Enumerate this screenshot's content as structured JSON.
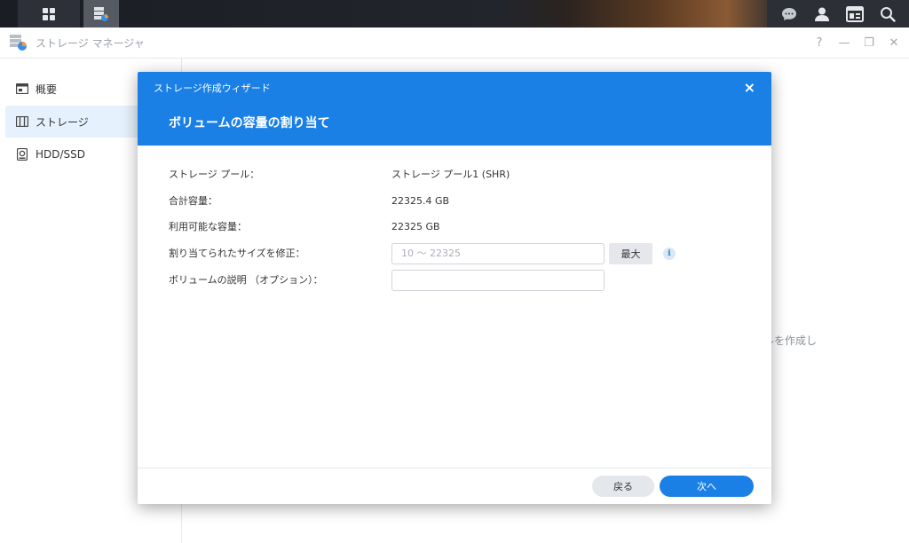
{
  "taskbar": {
    "icons": [
      "main-menu-icon",
      "storage-manager-app-icon",
      "chat-icon",
      "user-icon",
      "widgets-icon",
      "search-icon"
    ]
  },
  "window": {
    "title": "ストレージ マネージャ",
    "controls": {
      "help": "?",
      "minimize": "—",
      "restore": "❐",
      "close": "✕"
    }
  },
  "sidebar": {
    "items": [
      {
        "label": "概要",
        "icon": "overview-icon",
        "active": false
      },
      {
        "label": "ストレージ",
        "icon": "storage-icon",
        "active": true
      },
      {
        "label": "HDD/SSD",
        "icon": "hdd-icon",
        "active": false
      }
    ]
  },
  "background": {
    "partial_text": "ルを作成し"
  },
  "wizard": {
    "title": "ストレージ作成ウィザード",
    "close": "×",
    "step_title": "ボリュームの容量の割り当て",
    "fields": {
      "pool_label": "ストレージ プール：",
      "pool_value": "ストレージ プール1 (SHR)",
      "total_label": "合計容量：",
      "total_value": "22325.4 GB",
      "available_label": "利用可能な容量：",
      "available_value": "22325 GB",
      "size_label": "割り当てられたサイズを修正：",
      "size_placeholder": "10 ～ 22325",
      "max_button": "最大",
      "info": "i",
      "desc_label": "ボリュームの説明 （オプション）：",
      "desc_placeholder": ""
    },
    "footer": {
      "back": "戻る",
      "next": "次へ"
    }
  },
  "colors": {
    "accent": "#1a80e6",
    "sidebar_active": "#e5f1fc"
  }
}
